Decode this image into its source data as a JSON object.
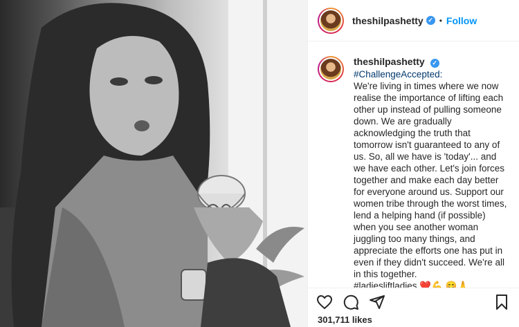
{
  "post": {
    "username": "theshilpashetty",
    "follow_label": "Follow",
    "separator": "•",
    "caption": {
      "hashtag": "#ChallengeAccepted:",
      "body": "We're living in times where we now realise the importance of lifting each other up instead of pulling someone down. We are gradually acknowledging the truth that tomorrow isn't guaranteed to any of us. So, all we have is 'today'... and we have each other. Let's join forces together and make each day better for everyone around us. Support our women tribe through the worst times, lend a helping hand (if possible) when you see another woman juggling too many things, and appreciate the efforts one has put in even if they didn't succeed. We're all in this together.",
      "tail": "#ladiesliftladies ❤️💪 😊🙏"
    },
    "likes_count": "301,711",
    "likes_label": "likes"
  },
  "icons": {
    "verified": "verified-badge-icon",
    "like": "heart-icon",
    "comment": "comment-icon",
    "share": "share-icon",
    "save": "bookmark-icon"
  },
  "colors": {
    "follow": "#0095f6",
    "verified": "#3897f0",
    "hashtag": "#00376b"
  }
}
